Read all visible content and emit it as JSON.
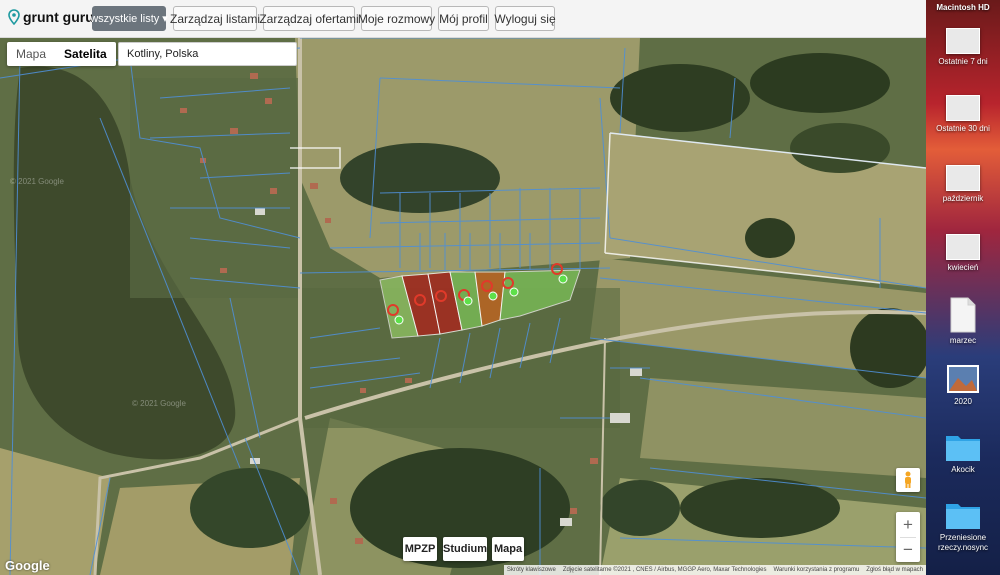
{
  "app": {
    "brand": "grunt guru"
  },
  "navbar": {
    "dropdown_label": "wszystkie listy ▾",
    "buttons": [
      "Zarządzaj listami",
      "Zarządzaj ofertami",
      "Moje rozmowy",
      "Mój profil",
      "Wyloguj się"
    ]
  },
  "map": {
    "maptype": {
      "map_label": "Mapa",
      "satellite_label": "Satelita",
      "selected": "Satelita"
    },
    "search_value": "Kotliny, Polska",
    "overlay_buttons": [
      "MPZP",
      "Studium",
      "Mapa"
    ],
    "zoom_in": "+",
    "zoom_out": "−",
    "google_logo": "Google",
    "watermarks": [
      "© 2021 Google",
      "© 2021 Google"
    ],
    "attribution": [
      "Skróty klawiszowe",
      "Zdjęcie satelitarne ©2021 , CNES / Airbus, MGGP Aero, Maxar Technologies",
      "Warunki korzystania z programu",
      "Zgłoś błąd w mapach"
    ],
    "colors": {
      "parcel_green": "#7ec85a",
      "parcel_red": "#b0201a",
      "parcel_orange": "#c8641e",
      "boundary": "#4f8fd6",
      "marker_red": "#e03a2a",
      "marker_green": "#5ee04a"
    }
  },
  "desktop": {
    "drive_label": "Macintosh HD",
    "items": [
      {
        "label": "Ostatnie 7 dni",
        "icon": "screenshot-thumbnail-icon"
      },
      {
        "label": "Ostatnie 30 dni",
        "icon": "screenshot-thumbnail-icon"
      },
      {
        "label": "październik",
        "icon": "screenshot-thumbnail-icon"
      },
      {
        "label": "kwiecień",
        "icon": "screenshot-thumbnail-icon"
      },
      {
        "label": "marzec",
        "icon": "document-icon"
      },
      {
        "label": "2020",
        "icon": "photo-icon"
      },
      {
        "label": "Akocik",
        "icon": "folder-icon"
      },
      {
        "label": "Przeniesione rzeczy.nosync",
        "icon": "folder-icon"
      }
    ]
  }
}
